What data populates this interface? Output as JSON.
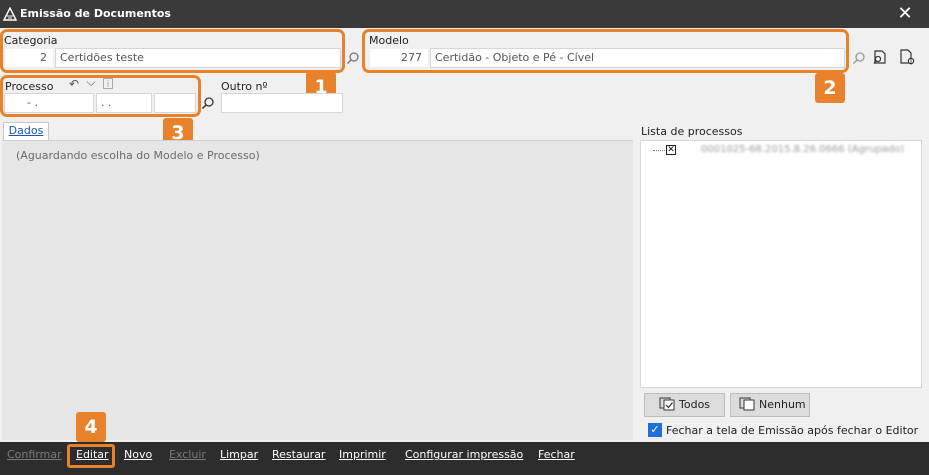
{
  "window": {
    "title": "Emissão de Documentos",
    "close_glyph": "✕"
  },
  "categoria": {
    "label": "Categoria",
    "code": "2",
    "name": "Certidões teste"
  },
  "modelo": {
    "label": "Modelo",
    "code": "277",
    "name": "Certidão - Objeto e Pé - Cível"
  },
  "processo": {
    "label": "Processo",
    "part1": "- .",
    "part2": ". .",
    "part3": "",
    "undo_glyph": "↶",
    "dropdown_glyph": "⌵"
  },
  "outro": {
    "label": "Outro nº",
    "value": ""
  },
  "badges": [
    "1",
    "2",
    "3",
    "4"
  ],
  "tabs": {
    "dados": "Dados"
  },
  "main": {
    "hint": "(Aguardando escolha do Modelo e Processo)"
  },
  "lista": {
    "label": "Lista de processos",
    "item": "0001025-68.2015.8.26.0666 (Agrupado)"
  },
  "buttons": {
    "todos": "Todos",
    "nenhum": "Nenhum"
  },
  "option": {
    "label": "Fechar a tela de Emissão após fechar o Editor",
    "checked": true
  },
  "bottombar": {
    "confirmar": "Confirmar",
    "editar": "Editar",
    "novo": "Novo",
    "excluir": "Excluir",
    "limpar": "Limpar",
    "restaurar": "Restaurar",
    "imprimir": "Imprimir",
    "configurar": "Configurar impressão",
    "fechar": "Fechar"
  },
  "colors": {
    "highlight": "#e8812b",
    "titlebar": "#3a3a3a",
    "checkbox": "#1e6fd9",
    "tab_text": "#1a56b3"
  },
  "icons": [
    "search-icon",
    "search-doc-icon",
    "doc-settings-icon",
    "undo-icon",
    "chevron-down-icon",
    "info-icon",
    "checkbox-x-icon",
    "check-all-icon",
    "uncheck-all-icon",
    "app-logo-icon",
    "close-icon"
  ]
}
